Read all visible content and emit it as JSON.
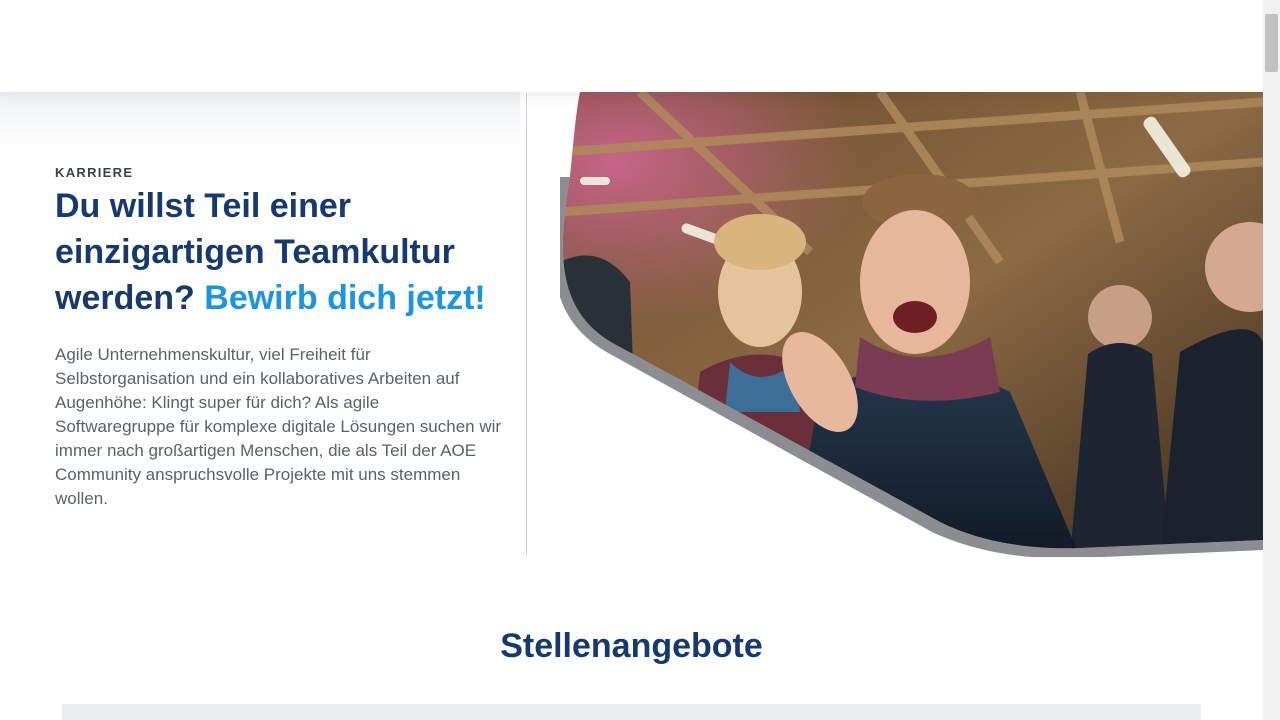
{
  "hero": {
    "kicker": "KARRIERE",
    "headline_main": "Du willst Teil einer einzigartigen Teamkultur werden?",
    "headline_accent": "Bewirb dich jetzt!",
    "intro": "Agile Unternehmenskultur, viel Freiheit für Selbstorganisation und ein kollaboratives Arbeiten auf Augenhöhe: Klingt super für dich? Als agile Softwaregruppe für komplexe digitale Lösungen suchen wir immer nach großartigen Menschen, die als Teil der AOE Community anspruchsvolle Projekte mit uns stemmen wollen."
  },
  "jobs": {
    "title": "Stellenangebote"
  },
  "colors": {
    "heading": "#163a6e",
    "accent": "#1b95e0",
    "body_text": "#5b6168"
  }
}
